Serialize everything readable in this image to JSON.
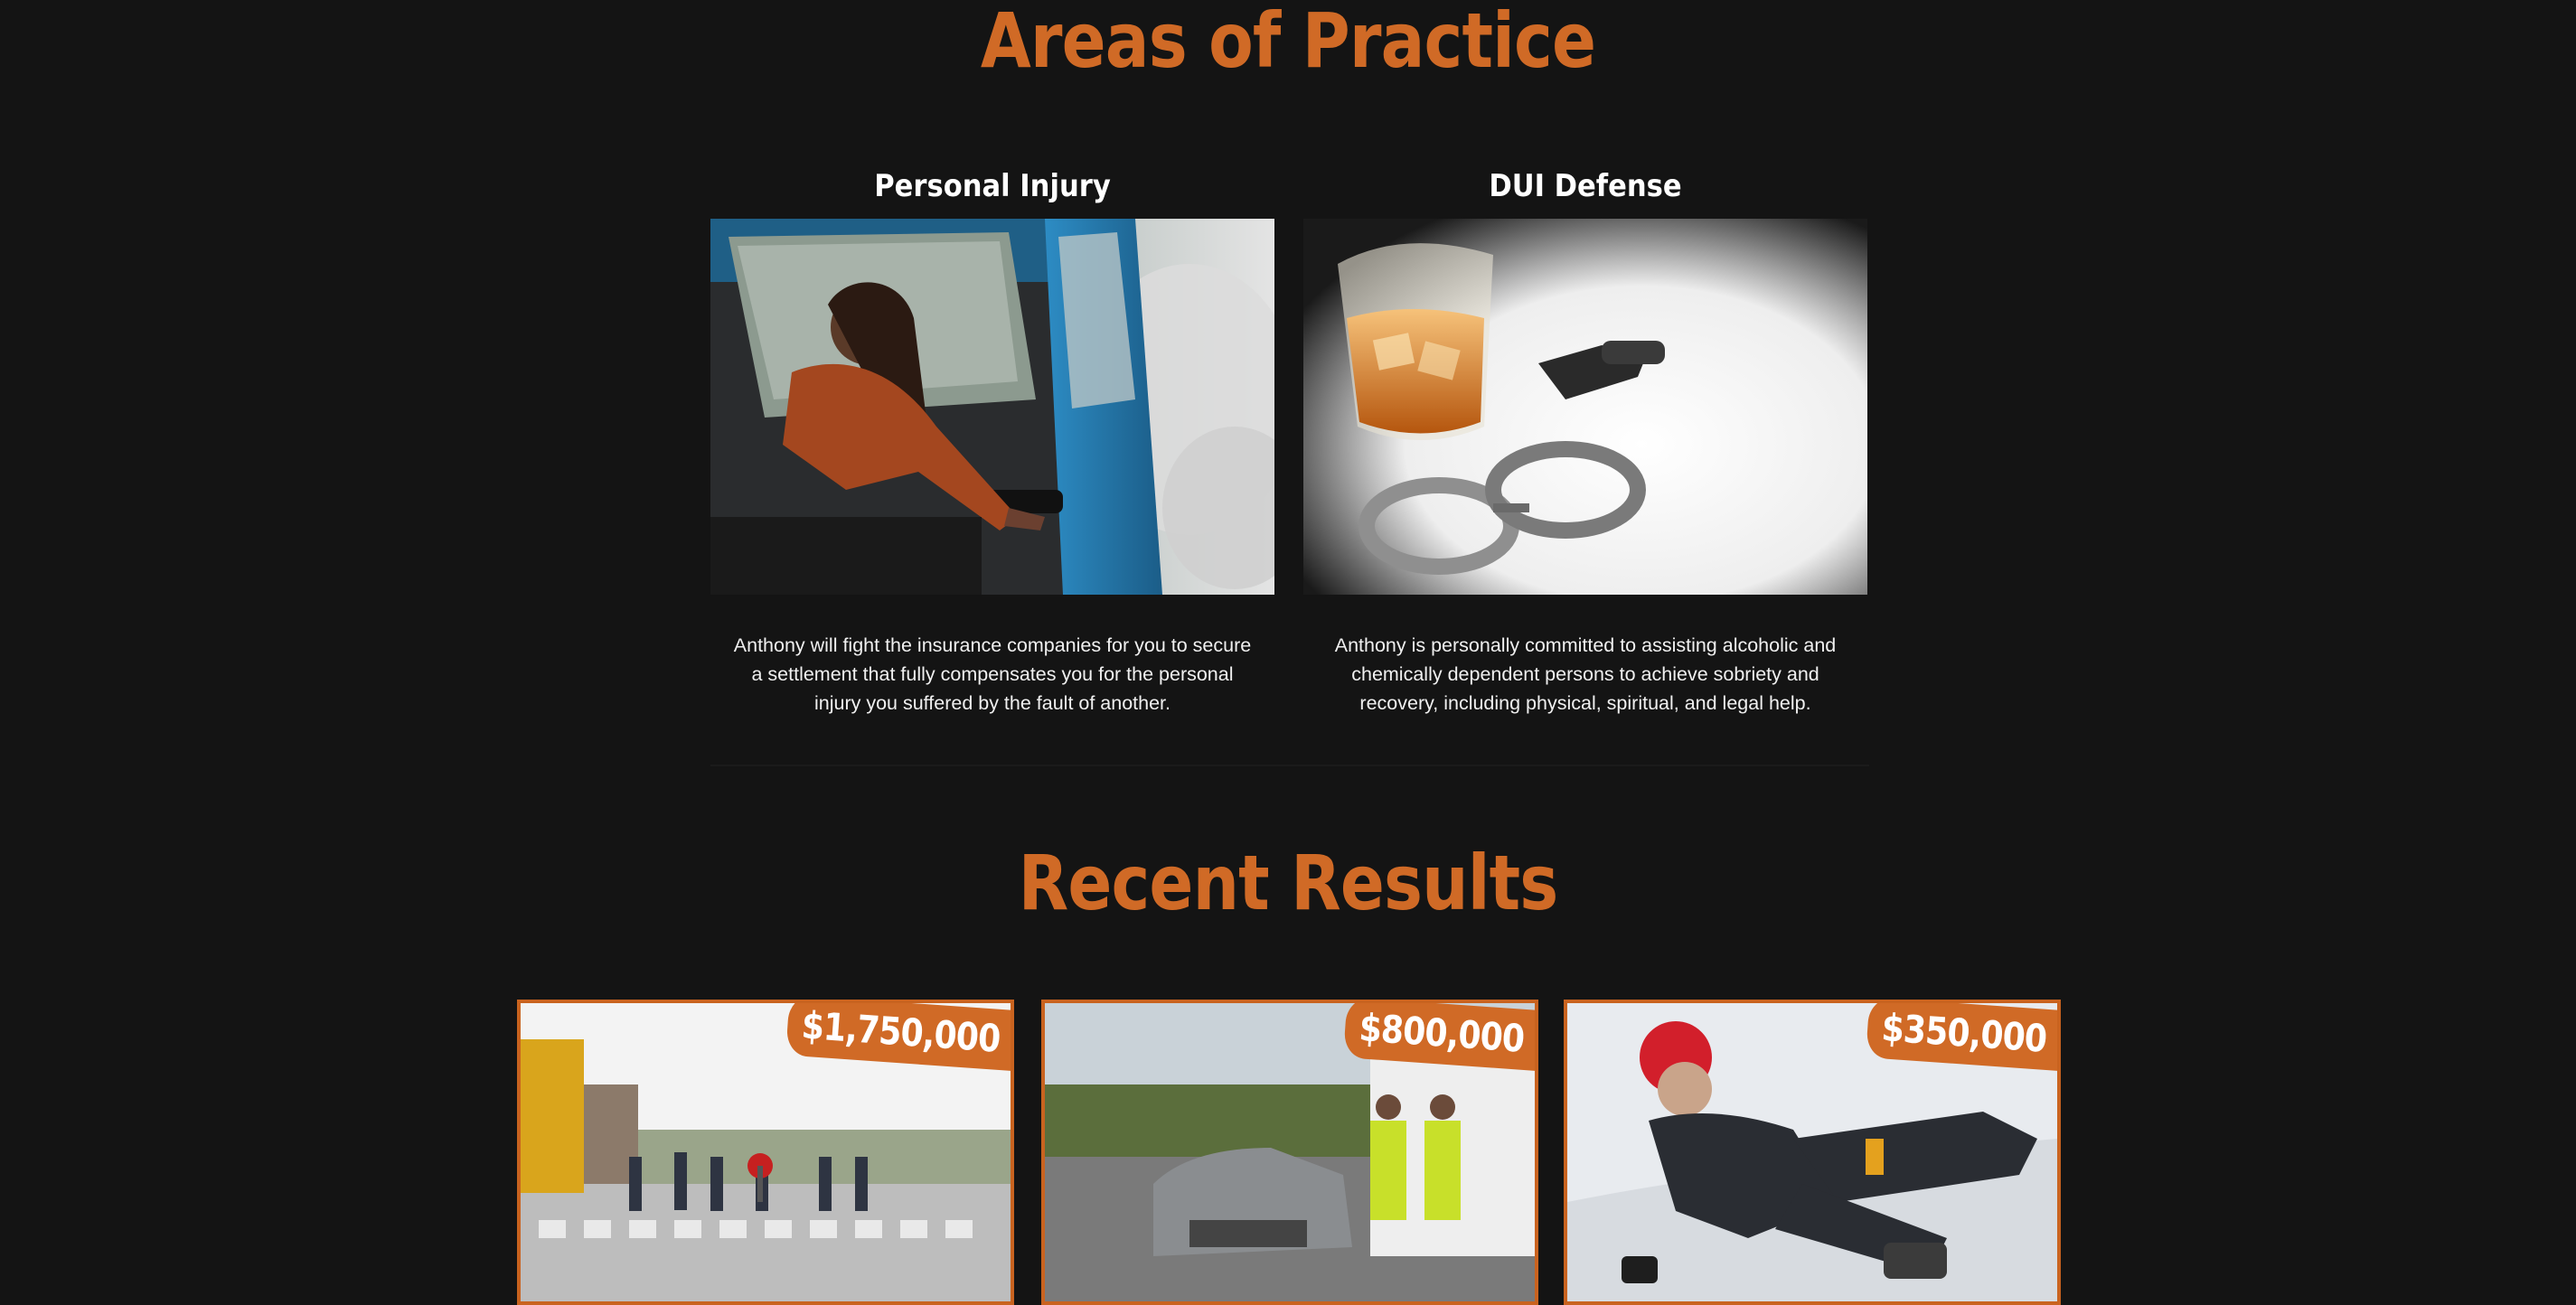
{
  "practice": {
    "title": "Areas of Practice",
    "areas": [
      {
        "heading": "Personal Injury",
        "image_icon": "car-accident-photo",
        "description": "Anthony will fight the insurance companies for you to secure a settlement that fully compensates you for the personal injury you suffered by the fault of another."
      },
      {
        "heading": "DUI Defense",
        "image_icon": "whiskey-keys-handcuffs-photo",
        "description": "Anthony is personally committed to assisting alcoholic and chemically dependent persons to achieve sobriety and recovery, including physical, spiritual, and legal help."
      }
    ]
  },
  "results": {
    "title": "Recent Results",
    "cards": [
      {
        "amount": "$1,750,000",
        "image_icon": "school-crosswalk-photo"
      },
      {
        "amount": "$800,000",
        "image_icon": "truck-car-collision-photo"
      },
      {
        "amount": "$350,000",
        "image_icon": "slip-and-fall-snow-photo"
      }
    ]
  },
  "colors": {
    "background": "#141414",
    "accent": "#d06a26",
    "text": "#ffffff"
  }
}
